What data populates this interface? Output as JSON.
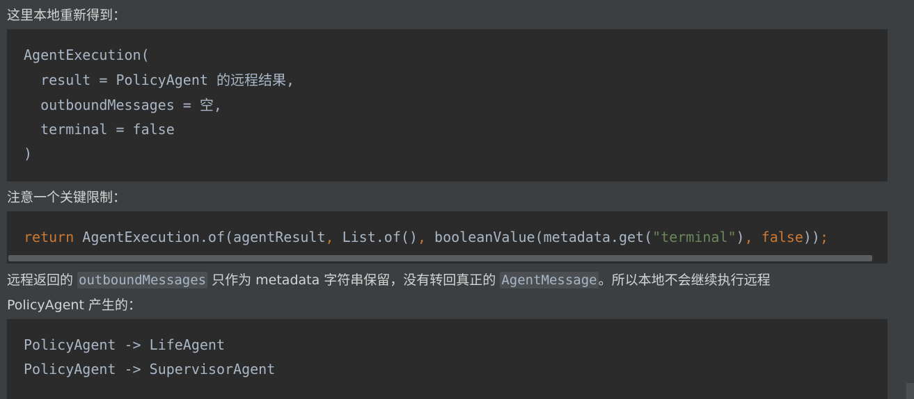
{
  "para1": "这里本地重新得到：",
  "block1": {
    "line1": "AgentExecution(",
    "line2": "  result = PolicyAgent 的远程结果,",
    "line3": "  outboundMessages = 空,",
    "line4": "  terminal = false",
    "line5": ")"
  },
  "para2": "注意一个关键限制：",
  "block2": {
    "kw_return": "return",
    "part1": " AgentExecution.of(agentResult",
    "comma1": ",",
    "part2": " List.of()",
    "comma2": ",",
    "part3": " booleanValue(metadata.get(",
    "str_terminal": "\"terminal\"",
    "part4": ")",
    "comma3": ",",
    "kw_false": " false",
    "part5": "))",
    "semicolon": ";"
  },
  "para3": {
    "t1": "远程返回的 ",
    "code1": "outboundMessages",
    "t2": " 只作为 metadata 字符串保留，没有转回真正的 ",
    "code2": "AgentMessage",
    "t3": "。所以本地不会继续执行远程",
    "line2": "PolicyAgent 产生的："
  },
  "block3": {
    "line1": "PolicyAgent -> LifeAgent",
    "line2": "PolicyAgent -> SupervisorAgent"
  }
}
